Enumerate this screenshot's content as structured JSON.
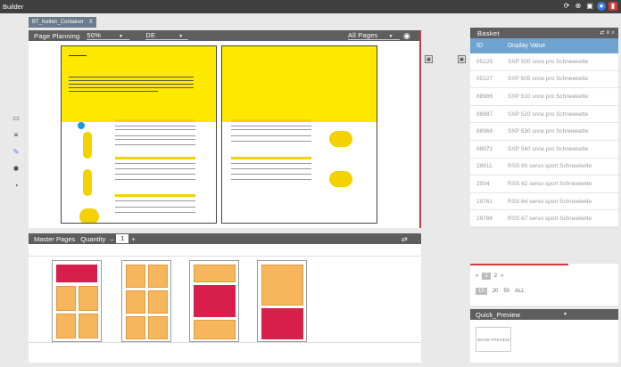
{
  "topbar": {
    "title": "Builder"
  },
  "tab": {
    "label": "BT_Ketten_Container",
    "close": "X"
  },
  "planning": {
    "title": "Page Planning",
    "zoom": "50%",
    "language": "DE",
    "pages_filter": "All Pages"
  },
  "master": {
    "title": "Master Pages",
    "quantity_label": "Quantity",
    "minus": "–",
    "quantity": "1",
    "plus": "+"
  },
  "basket": {
    "title": "Basket",
    "col_id": "ID",
    "col_value": "Display Value",
    "rows": [
      {
        "id": "05125",
        "value": "SXP 500 snox pro Schneekette"
      },
      {
        "id": "05127",
        "value": "SXP 505 snox pro Schneekette"
      },
      {
        "id": "88986",
        "value": "SXP 510 snox pro Schneekette"
      },
      {
        "id": "88987",
        "value": "SXP 520 snox pro Schneekette"
      },
      {
        "id": "88968",
        "value": "SXP 530 snox pro Schneekette"
      },
      {
        "id": "88972",
        "value": "SXP 540 snox pro Schneekette"
      },
      {
        "id": "29611",
        "value": "RSS 60 servo sport Schneekette"
      },
      {
        "id": "2934",
        "value": "RSS 62 servo sport Schneekette"
      },
      {
        "id": "29761",
        "value": "RSS 64 servo sport Schneekette"
      },
      {
        "id": "29786",
        "value": "RSS 67 servo sport Schneekette"
      }
    ]
  },
  "pager": {
    "prev": "«",
    "p1": "1",
    "p2": "2",
    "next": "»",
    "s10": "10",
    "s20": "20",
    "s50": "50",
    "all": "ALL"
  },
  "quick": {
    "title": "Quick_Preview",
    "preview": "IMAGE PREVIEW"
  }
}
